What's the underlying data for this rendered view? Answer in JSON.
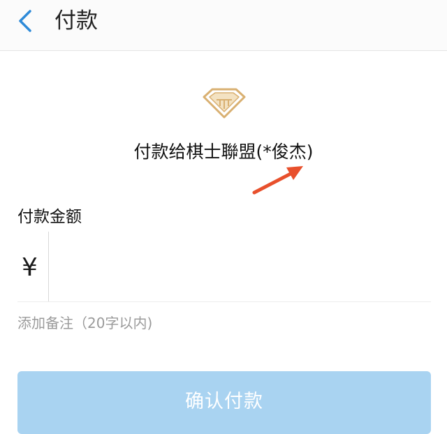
{
  "header": {
    "title": "付款",
    "back_icon": "chevron-left-icon"
  },
  "logo_icon": "diamond-logo-icon",
  "payee": {
    "text": "付款给棋士聯盟(*俊杰)"
  },
  "annotation_icon": "red-arrow-icon",
  "amount": {
    "label": "付款金额",
    "currency_symbol": "¥",
    "value": ""
  },
  "remark": {
    "text": "添加备注（20字以内)"
  },
  "confirm": {
    "label": "确认付款"
  },
  "colors": {
    "accent": "#2e8ad8",
    "button_disabled": "#a9d3f1",
    "logo_gold": "#d9b071",
    "annotation_red": "#e8502c"
  }
}
